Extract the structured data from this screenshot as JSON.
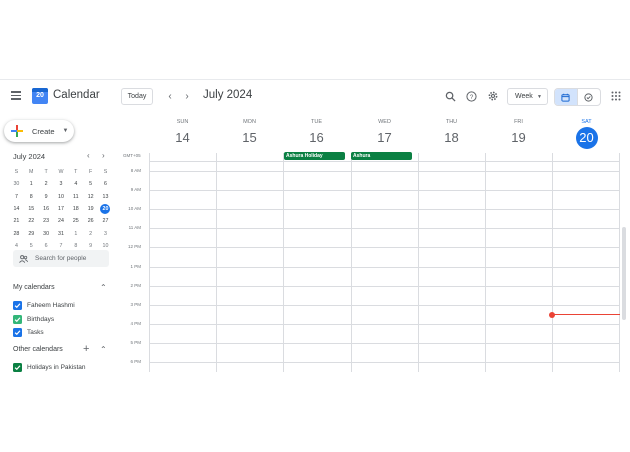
{
  "header": {
    "app_title": "Calendar",
    "logo_day": "20",
    "today_label": "Today",
    "period_title": "July 2024",
    "view_label": "Week",
    "icons": [
      "menu-icon",
      "search-icon",
      "help-icon",
      "settings-icon",
      "calendar-view-icon",
      "tasks-view-icon",
      "apps-grid-icon"
    ]
  },
  "sidebar": {
    "create_label": "Create",
    "mini_calendar": {
      "title": "July 2024",
      "dow": [
        "S",
        "M",
        "T",
        "W",
        "T",
        "F",
        "S"
      ],
      "weeks": [
        [
          "30",
          "1",
          "2",
          "3",
          "4",
          "5",
          "6"
        ],
        [
          "7",
          "8",
          "9",
          "10",
          "11",
          "12",
          "13"
        ],
        [
          "14",
          "15",
          "16",
          "17",
          "18",
          "19",
          "20"
        ],
        [
          "21",
          "22",
          "23",
          "24",
          "25",
          "26",
          "27"
        ],
        [
          "28",
          "29",
          "30",
          "31",
          "1",
          "2",
          "3"
        ],
        [
          "4",
          "5",
          "6",
          "7",
          "8",
          "9",
          "10"
        ]
      ],
      "selected": "20"
    },
    "search_placeholder": "Search for people",
    "my_calendars_title": "My calendars",
    "my_calendars": [
      {
        "label": "Faheem Hashmi",
        "color": "#1a73e8"
      },
      {
        "label": "Birthdays",
        "color": "#33b679"
      },
      {
        "label": "Tasks",
        "color": "#1a73e8"
      }
    ],
    "other_calendars_title": "Other calendars",
    "other_calendars": [
      {
        "label": "Holidays in Pakistan",
        "color": "#0b8043"
      }
    ]
  },
  "week": {
    "timezone": "GMT+05",
    "days": [
      {
        "dow": "SUN",
        "date": "14"
      },
      {
        "dow": "MON",
        "date": "15"
      },
      {
        "dow": "TUE",
        "date": "16"
      },
      {
        "dow": "WED",
        "date": "17"
      },
      {
        "dow": "THU",
        "date": "18"
      },
      {
        "dow": "FRI",
        "date": "19"
      },
      {
        "dow": "SAT",
        "date": "20"
      }
    ],
    "today_date": "20",
    "hours": [
      "8 AM",
      "9 AM",
      "10 AM",
      "11 AM",
      "12 PM",
      "1 PM",
      "2 PM",
      "3 PM",
      "4 PM",
      "5 PM",
      "6 PM"
    ],
    "all_day_events": [
      {
        "title": "Ashura Holiday",
        "day": "TUE",
        "color": "#0b8043"
      },
      {
        "title": "Ashura",
        "day": "WED",
        "color": "#0b8043"
      }
    ]
  },
  "colors": {
    "accent": "#1a73e8",
    "now_line": "#ea4335",
    "holiday": "#0b8043"
  }
}
